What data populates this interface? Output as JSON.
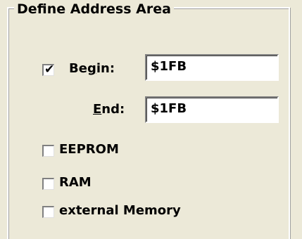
{
  "group": {
    "title": "Define Address Area"
  },
  "begin": {
    "label_pre": "Be",
    "label_u": "g",
    "label_post": "in:",
    "checked": true,
    "value": "$1FB"
  },
  "end": {
    "label_u": "E",
    "label_post": "nd:",
    "value": "$1FB"
  },
  "options": [
    {
      "label": "EEPROM",
      "checked": false
    },
    {
      "label": "RAM",
      "checked": false
    },
    {
      "label": "external Memory",
      "checked": false
    }
  ]
}
